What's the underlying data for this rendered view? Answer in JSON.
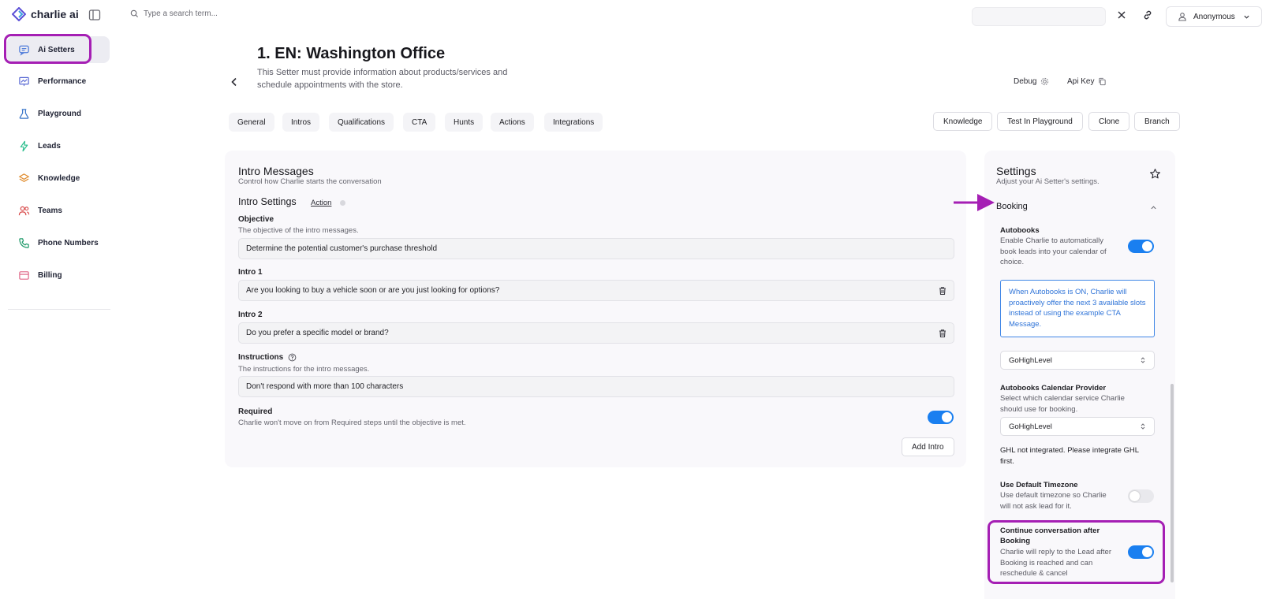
{
  "app": {
    "brand": "charlie ai"
  },
  "sidebar": {
    "items": [
      {
        "label": "Ai Setters",
        "icon": "chat-bubble-icon",
        "active": true
      },
      {
        "label": "Performance",
        "icon": "chart-icon"
      },
      {
        "label": "Playground",
        "icon": "flask-icon"
      },
      {
        "label": "Leads",
        "icon": "lightning-icon"
      },
      {
        "label": "Knowledge",
        "icon": "layers-icon"
      },
      {
        "label": "Teams",
        "icon": "users-icon"
      },
      {
        "label": "Phone Numbers",
        "icon": "phone-icon"
      },
      {
        "label": "Billing",
        "icon": "credit-card-icon"
      }
    ]
  },
  "topbar": {
    "search_placeholder": "Type a search term...",
    "user_name": "Anonymous"
  },
  "header": {
    "title": "1. EN: Washington Office",
    "description": "This Setter must provide information about products/services and schedule appointments with the store.",
    "debug_label": "Debug",
    "api_key_label": "Api Key"
  },
  "tabs": [
    "General",
    "Intros",
    "Qualifications",
    "CTA",
    "Hunts",
    "Actions",
    "Integrations"
  ],
  "actions": [
    "Knowledge",
    "Test In Playground",
    "Clone",
    "Branch"
  ],
  "intro": {
    "title": "Intro Messages",
    "subtitle": "Control how Charlie starts the conversation",
    "settings_title": "Intro Settings",
    "action_link": "Action",
    "objective_label": "Objective",
    "objective_desc": "The objective of the intro messages.",
    "objective_value": "Determine the potential customer's purchase threshold",
    "intro1_label": "Intro 1",
    "intro1_value": "Are you looking to buy a vehicle soon or are you just looking for options?",
    "intro2_label": "Intro 2",
    "intro2_value": "Do you prefer a specific model or brand?",
    "instructions_label": "Instructions",
    "instructions_desc": "The instructions for the intro messages.",
    "instructions_value": "Don't respond with more than 100 characters",
    "required_label": "Required",
    "required_desc": "Charlie won't move on from Required steps until the objective is met.",
    "required_on": true,
    "add_intro_label": "Add Intro"
  },
  "settings": {
    "title": "Settings",
    "subtitle": "Adjust your Ai Setter's settings.",
    "section": "Booking",
    "autobooks_label": "Autobooks",
    "autobooks_desc": "Enable Charlie to automatically book leads into your calendar of choice.",
    "autobooks_on": true,
    "info": "When Autobooks is ON, Charlie will proactively offer the next 3 available slots instead of using the example CTA Message.",
    "provider_select": "GoHighLevel",
    "calendar_label": "Autobooks Calendar Provider",
    "calendar_desc": "Select which calendar service Charlie should use for booking.",
    "calendar_select": "GoHighLevel",
    "ghl_note": "GHL not integrated. Please integrate GHL first.",
    "timezone_label": "Use Default Timezone",
    "timezone_desc": "Use default timezone so Charlie will not ask lead for it.",
    "timezone_on": false,
    "continue_label": "Continue conversation after Booking",
    "continue_desc": "Charlie will reply to the Lead after Booking is reached and can reschedule & cancel",
    "continue_on": true
  },
  "colors": {
    "accent": "#1a7ff0",
    "highlight": "#a51fb4"
  }
}
